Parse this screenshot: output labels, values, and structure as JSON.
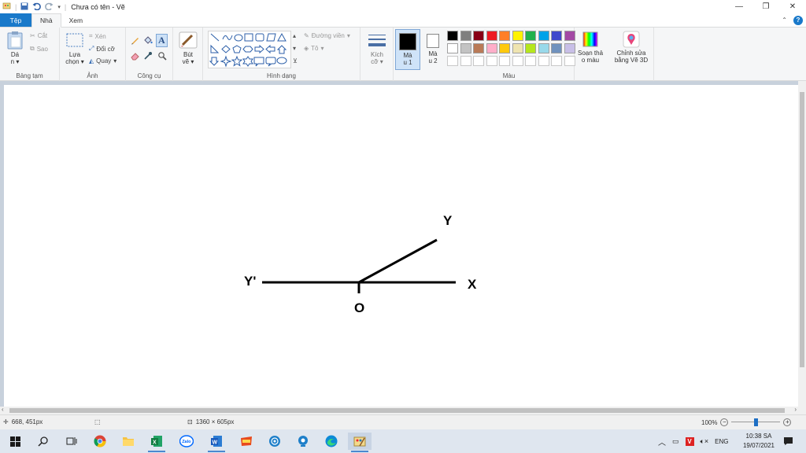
{
  "window": {
    "title": "Chưa có tên - Vẽ",
    "controls": {
      "minimize": "—",
      "restore": "❐",
      "close": "✕"
    }
  },
  "tabs": [
    {
      "label": "Tệp"
    },
    {
      "label": "Nhà"
    },
    {
      "label": "Xem"
    }
  ],
  "ribbon": {
    "clipboard": {
      "paste_line1": "Dá",
      "paste_line2": "n",
      "cut": "Cắt",
      "copy": "Sao",
      "group": "Bảng tạm"
    },
    "image": {
      "select_line1": "Lựa",
      "select_line2": "chọn",
      "crop": "Xén",
      "resize": "Đổi cỡ",
      "rotate": "Quay",
      "group": "Ảnh"
    },
    "tools": {
      "group": "Công cụ"
    },
    "brushes": {
      "line1": "Bút",
      "line2": "vẽ"
    },
    "shapes": {
      "outline": "Đường viền",
      "fill": "Tô",
      "group": "Hình dạng"
    },
    "size": {
      "line1": "Kích",
      "line2": "cỡ"
    },
    "color1": {
      "line1": "Mà",
      "line2": "u 1"
    },
    "color2": {
      "line1": "Mà",
      "line2": "u 2"
    },
    "colors": {
      "group": "Màu"
    },
    "edit_colors": {
      "line1": "Soạn thả",
      "line2": "o màu"
    },
    "paint3d": {
      "line1": "Chỉnh sửa",
      "line2": "bằng Vẽ 3D"
    }
  },
  "palette": {
    "row1": [
      "#000000",
      "#7f7f7f",
      "#880015",
      "#ed1c24",
      "#ff7f27",
      "#fff200",
      "#22b14c",
      "#00a2e8",
      "#3f48cc",
      "#a349a4"
    ],
    "row2": [
      "#ffffff",
      "#c3c3c3",
      "#b97a57",
      "#ffaec9",
      "#ffc90e",
      "#efe4b0",
      "#b5e61d",
      "#99d9ea",
      "#7092be",
      "#c8bfe7"
    ]
  },
  "drawing": {
    "labels": {
      "y": "Y",
      "y_prime": "Y'",
      "x": "X",
      "o": "O"
    }
  },
  "status": {
    "cursor": "668, 451px",
    "canvas_size": "1360 × 605px",
    "zoom": "100%",
    "zoom_fraction": 0.5
  },
  "taskbar": {
    "tray_lang": "ENG",
    "time": "10:38 SA",
    "date": "19/07/2021"
  }
}
